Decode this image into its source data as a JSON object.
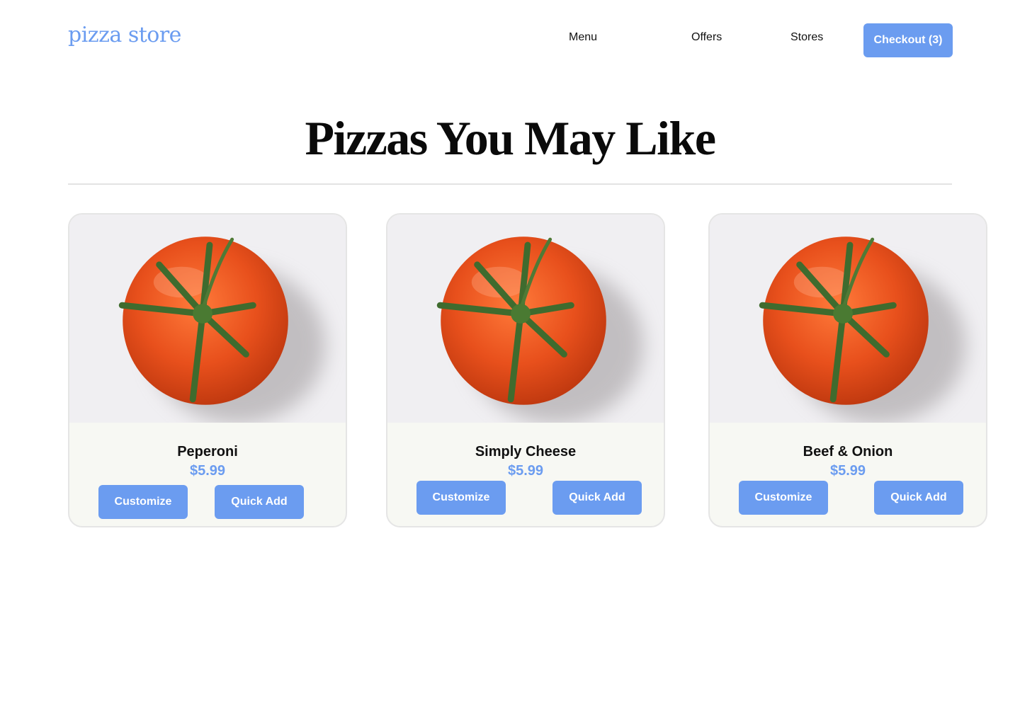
{
  "header": {
    "logo": "pizza store",
    "nav": [
      "Menu",
      "Offers",
      "Stores"
    ],
    "checkout_label": "Checkout (3)"
  },
  "main": {
    "title": "Pizzas You May Like",
    "products": [
      {
        "name": "Peperoni",
        "price": "$5.99",
        "image_icon": "tomato-image",
        "customize_label": "Customize",
        "quick_add_label": "Quick Add"
      },
      {
        "name": "Simply Cheese",
        "price": "$5.99",
        "image_icon": "tomato-image",
        "customize_label": "Customize",
        "quick_add_label": "Quick Add"
      },
      {
        "name": "Beef & Onion",
        "price": "$5.99",
        "image_icon": "tomato-image",
        "customize_label": "Customize",
        "quick_add_label": "Quick Add"
      }
    ]
  },
  "colors": {
    "accent": "#6b9cf0",
    "card_footer": "#f7f8f3",
    "image_bg": "#f0eff2",
    "tomato": "#e8501c"
  }
}
